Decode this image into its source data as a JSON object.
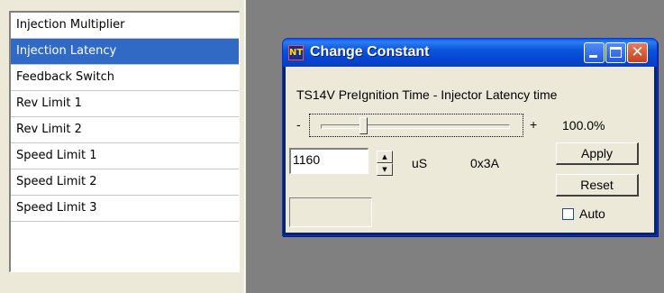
{
  "list": {
    "items": [
      {
        "label": "Injection Multiplier"
      },
      {
        "label": "Injection Latency"
      },
      {
        "label": "Feedback Switch"
      },
      {
        "label": "Rev Limit 1"
      },
      {
        "label": "Rev Limit 2"
      },
      {
        "label": "Speed Limit 1"
      },
      {
        "label": "Speed Limit 2"
      },
      {
        "label": "Speed Limit 3"
      }
    ],
    "selected_index": 1
  },
  "dialog": {
    "title": "Change Constant",
    "icon_text": "NT",
    "description": "TS14V PreIgnition Time - Injector Latency time",
    "slider": {
      "minus_label": "-",
      "plus_label": "+",
      "fraction": 0.23
    },
    "percent": "100.0%",
    "value": "1160",
    "unit": "uS",
    "hex": "0x3A",
    "apply_label": "Apply",
    "reset_label": "Reset",
    "auto_label": "Auto",
    "close_glyph": "✕"
  },
  "colors": {
    "selection": "#316ac5",
    "titlebar": "#0a5ae0",
    "workspace": "#808080"
  }
}
